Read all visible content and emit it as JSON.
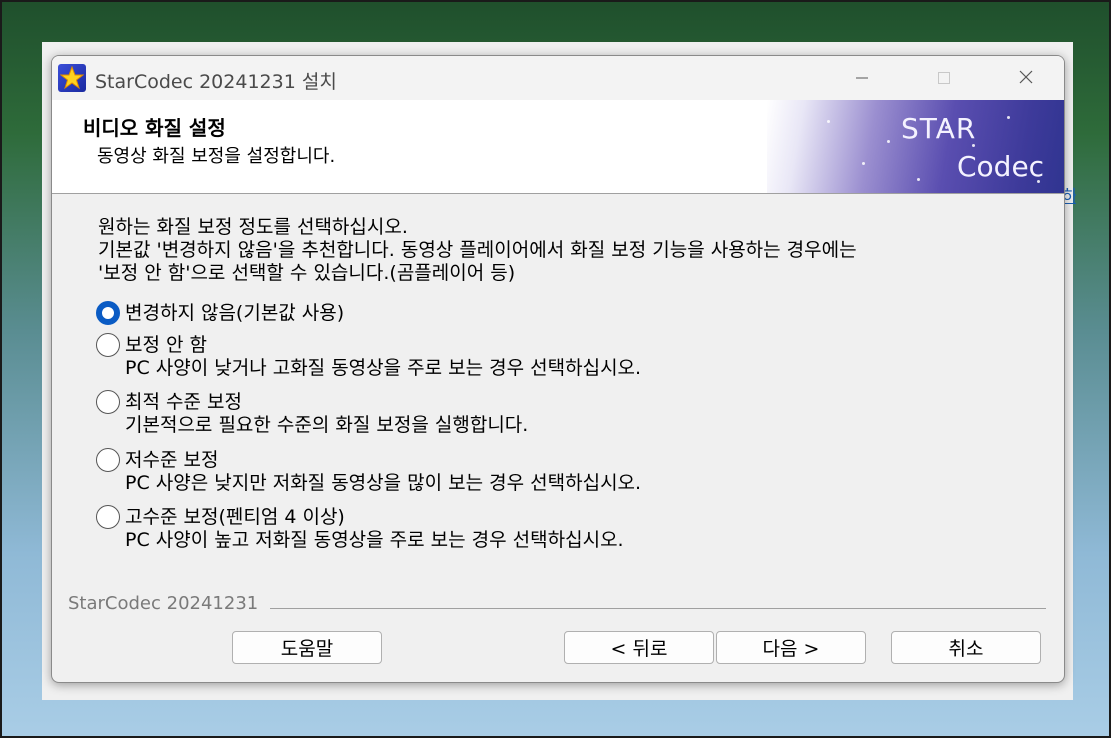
{
  "window": {
    "title": "StarCodec 20241231 설치"
  },
  "header": {
    "title": "비디오 화질 설정",
    "subtitle": "동영상 화질 보정을 설정합니다.",
    "logo_star": "STAR",
    "logo_codec": "Codec"
  },
  "intro": {
    "line1": "원하는 화질 보정 정도를 선택하십시오.",
    "line2": "기본값 '변경하지 않음'을 추천합니다. 동영상 플레이어에서 화질 보정 기능을 사용하는 경우에는",
    "line3": "'보정 안 함'으로 선택할 수 있습니다.(곰플레이어 등)"
  },
  "options": [
    {
      "label": "변경하지 않음(기본값 사용)",
      "desc": "",
      "checked": true
    },
    {
      "label": "보정 안 함",
      "desc": "PC 사양이 낮거나 고화질 동영상을 주로 보는 경우 선택하십시오.",
      "checked": false
    },
    {
      "label": "최적 수준 보정",
      "desc": "기본적으로 필요한 수준의 화질 보정을 실행합니다.",
      "checked": false
    },
    {
      "label": "저수준 보정",
      "desc": "PC 사양은 낮지만 저화질 동영상을 많이 보는 경우 선택하십시오.",
      "checked": false
    },
    {
      "label": "고수준 보정(펜티엄 4 이상)",
      "desc": "PC 사양이 높고 저화질 동영상을 주로 보는 경우 선택하십시오.",
      "checked": false
    }
  ],
  "footer": {
    "brand": "StarCodec 20241231",
    "help": "도움말",
    "back": "< 뒤로",
    "next": "다음 >",
    "cancel": "취소"
  },
  "background": {
    "edge_link_text": "하"
  },
  "colors": {
    "accent": "#0a5bc4"
  }
}
